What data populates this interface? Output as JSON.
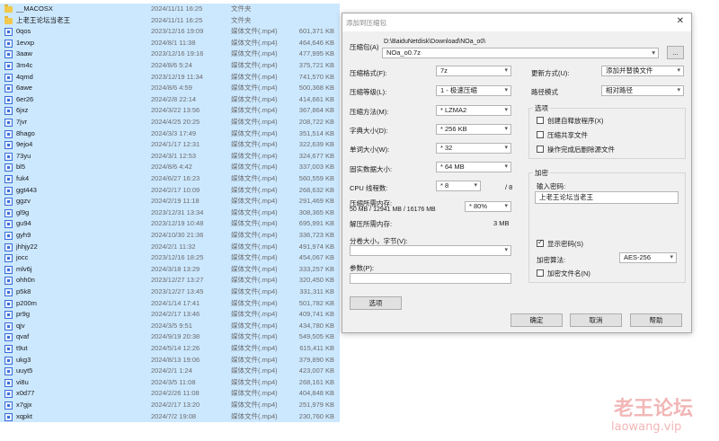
{
  "files": [
    {
      "name": "__MACOSX",
      "date": "2024/11/11 16:25",
      "type": "文件夹",
      "size": "",
      "icon": "folder-icon",
      "selected": true
    },
    {
      "name": "上老王论坛当老王",
      "date": "2024/11/11 16:25",
      "type": "文件夹",
      "size": "",
      "icon": "folder-icon",
      "selected": true
    },
    {
      "name": "0qos",
      "date": "2023/12/16 19:09",
      "type": "媒体文件(.mp4)",
      "size": "601,371 KB",
      "icon": "media-file-icon",
      "selected": true
    },
    {
      "name": "1evxp",
      "date": "2024/8/1 11:38",
      "type": "媒体文件(.mp4)",
      "size": "464,646 KB",
      "icon": "media-file-icon",
      "selected": true
    },
    {
      "name": "3aaw",
      "date": "2023/12/16 19:16",
      "type": "媒体文件(.mp4)",
      "size": "477,995 KB",
      "icon": "media-file-icon",
      "selected": true
    },
    {
      "name": "3m4c",
      "date": "2024/8/6 5:24",
      "type": "媒体文件(.mp4)",
      "size": "375,721 KB",
      "icon": "media-file-icon",
      "selected": true
    },
    {
      "name": "4qmd",
      "date": "2023/12/19 11:34",
      "type": "媒体文件(.mp4)",
      "size": "741,570 KB",
      "icon": "media-file-icon",
      "selected": true
    },
    {
      "name": "6awe",
      "date": "2024/8/6 4:59",
      "type": "媒体文件(.mp4)",
      "size": "500,368 KB",
      "icon": "media-file-icon",
      "selected": true
    },
    {
      "name": "6er26",
      "date": "2024/2/8 22:14",
      "type": "媒体文件(.mp4)",
      "size": "414,661 KB",
      "icon": "media-file-icon",
      "selected": true
    },
    {
      "name": "6jxz",
      "date": "2024/3/22 13:56",
      "type": "媒体文件(.mp4)",
      "size": "367,864 KB",
      "icon": "media-file-icon",
      "selected": true
    },
    {
      "name": "7jvr",
      "date": "2024/4/25 20:25",
      "type": "媒体文件(.mp4)",
      "size": "208,722 KB",
      "icon": "media-file-icon",
      "selected": true
    },
    {
      "name": "8hago",
      "date": "2024/3/3 17:49",
      "type": "媒体文件(.mp4)",
      "size": "351,514 KB",
      "icon": "media-file-icon",
      "selected": true
    },
    {
      "name": "9ejo4",
      "date": "2024/1/17 12:31",
      "type": "媒体文件(.mp4)",
      "size": "322,639 KB",
      "icon": "media-file-icon",
      "selected": true
    },
    {
      "name": "73yu",
      "date": "2024/3/1 12:53",
      "type": "媒体文件(.mp4)",
      "size": "324,677 KB",
      "icon": "media-file-icon",
      "selected": true
    },
    {
      "name": "bl5",
      "date": "2024/8/6 4:42",
      "type": "媒体文件(.mp4)",
      "size": "337,003 KB",
      "icon": "media-file-icon",
      "selected": true
    },
    {
      "name": "fuk4",
      "date": "2024/6/27 16:23",
      "type": "媒体文件(.mp4)",
      "size": "560,559 KB",
      "icon": "media-file-icon",
      "selected": true
    },
    {
      "name": "ggt443",
      "date": "2024/2/17 10:09",
      "type": "媒体文件(.mp4)",
      "size": "268,632 KB",
      "icon": "media-file-icon",
      "selected": true
    },
    {
      "name": "ggzv",
      "date": "2024/2/19 11:18",
      "type": "媒体文件(.mp4)",
      "size": "291,469 KB",
      "icon": "media-file-icon",
      "selected": true
    },
    {
      "name": "gl9g",
      "date": "2023/12/31 13:34",
      "type": "媒体文件(.mp4)",
      "size": "308,365 KB",
      "icon": "media-file-icon",
      "selected": true
    },
    {
      "name": "gu94",
      "date": "2023/12/19 10:48",
      "type": "媒体文件(.mp4)",
      "size": "695,991 KB",
      "icon": "media-file-icon",
      "selected": true
    },
    {
      "name": "gyh9",
      "date": "2024/10/30 21:36",
      "type": "媒体文件(.mp4)",
      "size": "336,723 KB",
      "icon": "media-file-icon",
      "selected": true
    },
    {
      "name": "jhhjy22",
      "date": "2024/2/1 11:32",
      "type": "媒体文件(.mp4)",
      "size": "491,974 KB",
      "icon": "media-file-icon",
      "selected": true
    },
    {
      "name": "jocc",
      "date": "2023/12/16 18:25",
      "type": "媒体文件(.mp4)",
      "size": "454,067 KB",
      "icon": "media-file-icon",
      "selected": true
    },
    {
      "name": "mlv6j",
      "date": "2024/3/18 13:29",
      "type": "媒体文件(.mp4)",
      "size": "333,257 KB",
      "icon": "media-file-icon",
      "selected": true
    },
    {
      "name": "ohh0n",
      "date": "2023/12/27 13:27",
      "type": "媒体文件(.mp4)",
      "size": "320,450 KB",
      "icon": "media-file-icon",
      "selected": true
    },
    {
      "name": "p5k8",
      "date": "2023/12/27 13:45",
      "type": "媒体文件(.mp4)",
      "size": "331,311 KB",
      "icon": "media-file-icon",
      "selected": true
    },
    {
      "name": "p200m",
      "date": "2024/1/14 17:41",
      "type": "媒体文件(.mp4)",
      "size": "501,782 KB",
      "icon": "media-file-icon",
      "selected": true
    },
    {
      "name": "pr9g",
      "date": "2024/2/17 13:46",
      "type": "媒体文件(.mp4)",
      "size": "409,741 KB",
      "icon": "media-file-icon",
      "selected": true
    },
    {
      "name": "qjv",
      "date": "2024/3/5 9:51",
      "type": "媒体文件(.mp4)",
      "size": "434,780 KB",
      "icon": "media-file-icon",
      "selected": true
    },
    {
      "name": "qvaf",
      "date": "2024/9/19 20:38",
      "type": "媒体文件(.mp4)",
      "size": "549,505 KB",
      "icon": "media-file-icon",
      "selected": true
    },
    {
      "name": "t9ut",
      "date": "2024/5/14 12:26",
      "type": "媒体文件(.mp4)",
      "size": "615,411 KB",
      "icon": "media-file-icon",
      "selected": true
    },
    {
      "name": "ukg3",
      "date": "2024/8/13 19:06",
      "type": "媒体文件(.mp4)",
      "size": "379,890 KB",
      "icon": "media-file-icon",
      "selected": true
    },
    {
      "name": "uuyt5",
      "date": "2024/2/1 1:24",
      "type": "媒体文件(.mp4)",
      "size": "423,007 KB",
      "icon": "media-file-icon",
      "selected": true
    },
    {
      "name": "vi8u",
      "date": "2024/3/5 11:08",
      "type": "媒体文件(.mp4)",
      "size": "268,161 KB",
      "icon": "media-file-icon",
      "selected": true
    },
    {
      "name": "x0d77",
      "date": "2024/2/26 11:08",
      "type": "媒体文件(.mp4)",
      "size": "404,848 KB",
      "icon": "media-file-icon",
      "selected": true
    },
    {
      "name": "x7gjx",
      "date": "2024/2/17 13:20",
      "type": "媒体文件(.mp4)",
      "size": "251,979 KB",
      "icon": "media-file-icon",
      "selected": true
    },
    {
      "name": "xqpkt",
      "date": "2024/7/2 19:08",
      "type": "媒体文件(.mp4)",
      "size": "230,760 KB",
      "icon": "media-file-icon",
      "selected": true
    }
  ],
  "dialog": {
    "title": "添加到压缩包",
    "close": "✕",
    "archive_label": "压缩包(A)",
    "archive_path": "D:\\BaiduNetdisk\\Download\\NOa_o0\\",
    "archive_name": "NOa_o0.7z",
    "browse": "...",
    "format_label": "压缩格式(F):",
    "format_value": "7z",
    "level_label": "压缩等级(L):",
    "level_value": "1 - 极速压缩",
    "method_label": "压缩方法(M):",
    "method_value": "* LZMA2",
    "dict_label": "字典大小(D):",
    "dict_value": "* 256 KB",
    "word_label": "单词大小(W):",
    "word_value": "* 32",
    "solid_label": "固实数据大小:",
    "solid_value": "* 64 MB",
    "cpu_label": "CPU 线程数:",
    "cpu_value": "* 8",
    "cpu_total": "/ 8",
    "mem_comp_label": "压缩所需内存:",
    "mem_comp_value": "50 MB / 12941 MB / 16176 MB",
    "mem_percent": "* 80%",
    "mem_decomp_label": "解压所需内存:",
    "mem_decomp_value": "3 MB",
    "split_label": "分卷大小，字节(V):",
    "params_label": "参数(P):",
    "options_button": "选项",
    "update_label": "更新方式(U):",
    "update_value": "添加并替换文件",
    "path_label": "路径模式",
    "path_value": "相对路径",
    "options_group": "选项",
    "opt_sfx": "创建自释放程序(X)",
    "opt_shared": "压缩共享文件",
    "opt_delete": "操作完成后删除源文件",
    "encrypt_group": "加密",
    "pwd_label": "输入密码:",
    "pwd_value": "上老王论坛当老王",
    "show_pwd": "显示密码(S)",
    "enc_method_label": "加密算法:",
    "enc_method_value": "AES-256",
    "enc_names": "加密文件名(N)",
    "ok": "确定",
    "cancel": "取消",
    "help": "帮助"
  },
  "watermark": {
    "line1": "老王论坛",
    "line2": "laowang.vip"
  },
  "colors": {
    "selection": "#cce8ff",
    "folder": "#f2c94c",
    "media_icon": "#3a6ed8",
    "watermark": "#f2b6b6"
  }
}
